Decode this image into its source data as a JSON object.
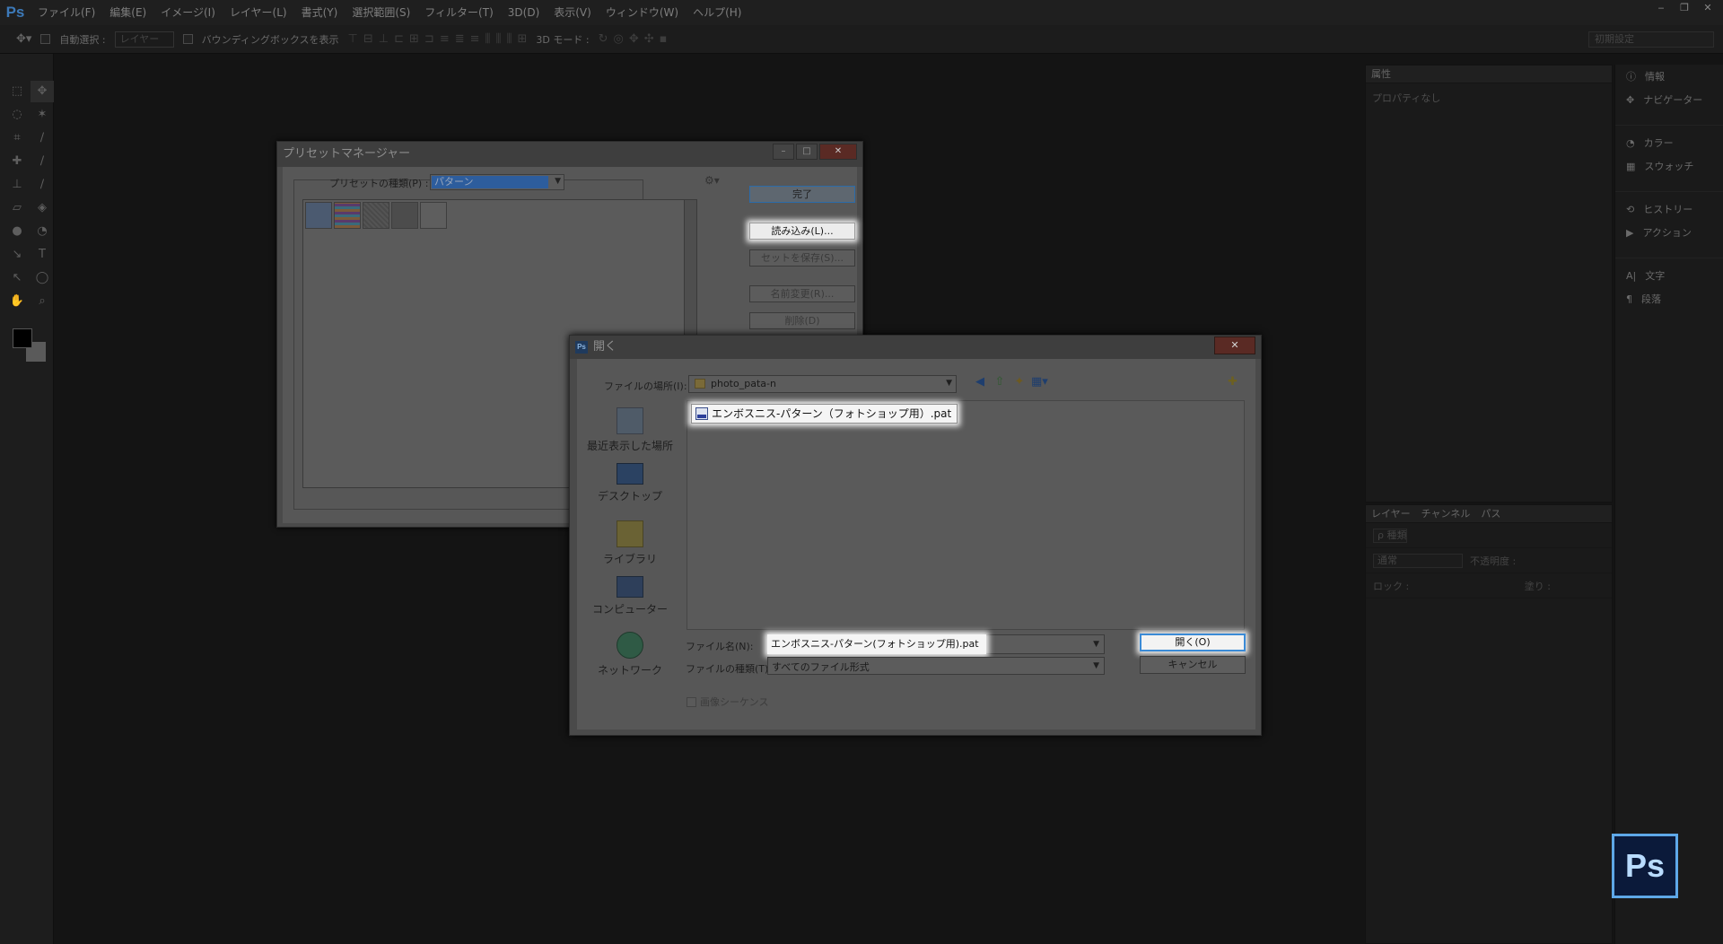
{
  "app": {
    "logo_text": "Ps",
    "menus": [
      "ファイル(F)",
      "編集(E)",
      "イメージ(I)",
      "レイヤー(L)",
      "書式(Y)",
      "選択範囲(S)",
      "フィルター(T)",
      "3D(D)",
      "表示(V)",
      "ウィンドウ(W)",
      "ヘルプ(H)"
    ],
    "window_controls": [
      "‒",
      "❐",
      "✕"
    ]
  },
  "options_bar": {
    "auto_select_label": "自動選択 :",
    "auto_select_value": "レイヤー",
    "bounding_box_label": "バウンディングボックスを表示",
    "mode_3d_label": "3D モード :",
    "workspace_value": "初期設定"
  },
  "properties_panel": {
    "tab": "属性",
    "empty_text": "プロパティなし"
  },
  "layers_panel": {
    "tabs": [
      "レイヤー",
      "チャンネル",
      "パス"
    ],
    "kind_filter": "ρ 種類",
    "blend_mode": "通常",
    "opacity_label": "不透明度 :",
    "lock_label": "ロック :",
    "fill_label": "塗り :"
  },
  "right_dock": {
    "items": [
      {
        "icon": "ⓘ",
        "label": "情報"
      },
      {
        "icon": "✥",
        "label": "ナビゲーター"
      },
      {
        "icon": "◔",
        "label": "カラー"
      },
      {
        "icon": "▦",
        "label": "スウォッチ"
      },
      {
        "icon": "⟲",
        "label": "ヒストリー"
      },
      {
        "icon": "▶",
        "label": "アクション"
      },
      {
        "icon": "A|",
        "label": "文字"
      },
      {
        "icon": "¶",
        "label": "段落"
      }
    ]
  },
  "preset_manager": {
    "title": "プリセットマネージャー",
    "preset_type_label": "プリセットの種類(P) :",
    "preset_type_value": "パターン",
    "done_button": "完了",
    "load_button": "読み込み(L)...",
    "save_set_button": "セットを保存(S)...",
    "rename_button": "名前変更(R)...",
    "delete_button": "削除(D)"
  },
  "open_dialog": {
    "title": "開く",
    "location_label": "ファイルの場所(I):",
    "location_value": "photo_pata-n",
    "places": [
      "最近表示した場所",
      "デスクトップ",
      "ライブラリ",
      "コンピューター",
      "ネットワーク"
    ],
    "file_list": [
      "エンボスニス-パターン（フォトショップ用）.pat"
    ],
    "filename_label": "ファイル名(N):",
    "filename_value": "エンボスニス-パターン(フォトショップ用).pat",
    "filetype_label": "ファイルの種類(T):",
    "filetype_value": "すべてのファイル形式",
    "open_button": "開く(O)",
    "cancel_button": "キャンセル",
    "image_sequence_label": "画像シーケンス"
  }
}
